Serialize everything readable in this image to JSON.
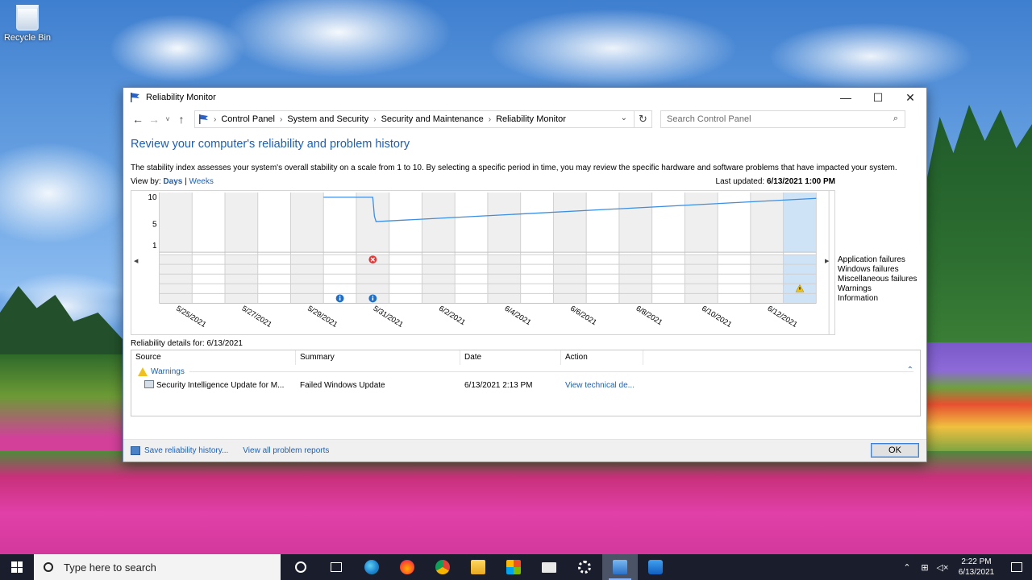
{
  "desktop": {
    "recycle_bin_label": "Recycle Bin"
  },
  "window": {
    "title": "Reliability Monitor",
    "controls": {
      "minimize": "—",
      "maximize": "☐",
      "close": "✕"
    }
  },
  "navbar": {
    "breadcrumbs": [
      "Control Panel",
      "System and Security",
      "Security and Maintenance",
      "Reliability Monitor"
    ],
    "search_placeholder": "Search Control Panel"
  },
  "page": {
    "heading": "Review your computer's reliability and problem history",
    "description": "The stability index assesses your system's overall stability on a scale from 1 to 10. By selecting a specific period in time, you may review the specific hardware and software problems that have impacted your system.",
    "view_by_label": "View by:",
    "view_days": "Days",
    "view_sep": " | ",
    "view_weeks": "Weeks",
    "last_updated_label": "Last updated:",
    "last_updated_value": "6/13/2021 1:00 PM"
  },
  "chart_data": {
    "type": "line",
    "y_ticks": [
      "10",
      "5",
      "1"
    ],
    "ylim": [
      1,
      10
    ],
    "x_labels": [
      "5/25/2021",
      "5/27/2021",
      "5/29/2021",
      "5/31/2021",
      "6/2/2021",
      "6/4/2021",
      "6/6/2021",
      "6/8/2021",
      "6/10/2021",
      "6/12/2021"
    ],
    "day_count": 20,
    "stability_series": [
      {
        "day": 5,
        "value": 10
      },
      {
        "day": 6.5,
        "value": 10
      },
      {
        "day": 6.55,
        "value": 6.5
      },
      {
        "day": 6.6,
        "value": 5.5
      },
      {
        "day": 20,
        "value": 9.8
      }
    ],
    "legend_rows": [
      "Application failures",
      "Windows failures",
      "Miscellaneous failures",
      "Warnings",
      "Information"
    ],
    "events": [
      {
        "day": 6,
        "row": 0,
        "kind": "error"
      },
      {
        "day": 5,
        "row": 4,
        "kind": "info"
      },
      {
        "day": 6,
        "row": 4,
        "kind": "info"
      },
      {
        "day": 19,
        "row": 3,
        "kind": "warning"
      }
    ],
    "selected_day": 19,
    "grid": true
  },
  "details": {
    "label": "Reliability details for: 6/13/2021",
    "columns": [
      "Source",
      "Summary",
      "Date",
      "Action"
    ],
    "group": "Warnings",
    "rows": [
      {
        "source": "Security Intelligence Update for M...",
        "summary": "Failed Windows Update",
        "date": "6/13/2021 2:13 PM",
        "action": "View technical de..."
      }
    ]
  },
  "footer": {
    "save_link": "Save reliability history...",
    "reports_link": "View all problem reports",
    "ok_label": "OK"
  },
  "taskbar": {
    "search_placeholder": "Type here to search",
    "time": "2:22 PM",
    "date": "6/13/2021"
  },
  "colors": {
    "accent": "#1e5fb4",
    "selected_column": "#cfe3f7",
    "line": "#3b8ee0"
  }
}
